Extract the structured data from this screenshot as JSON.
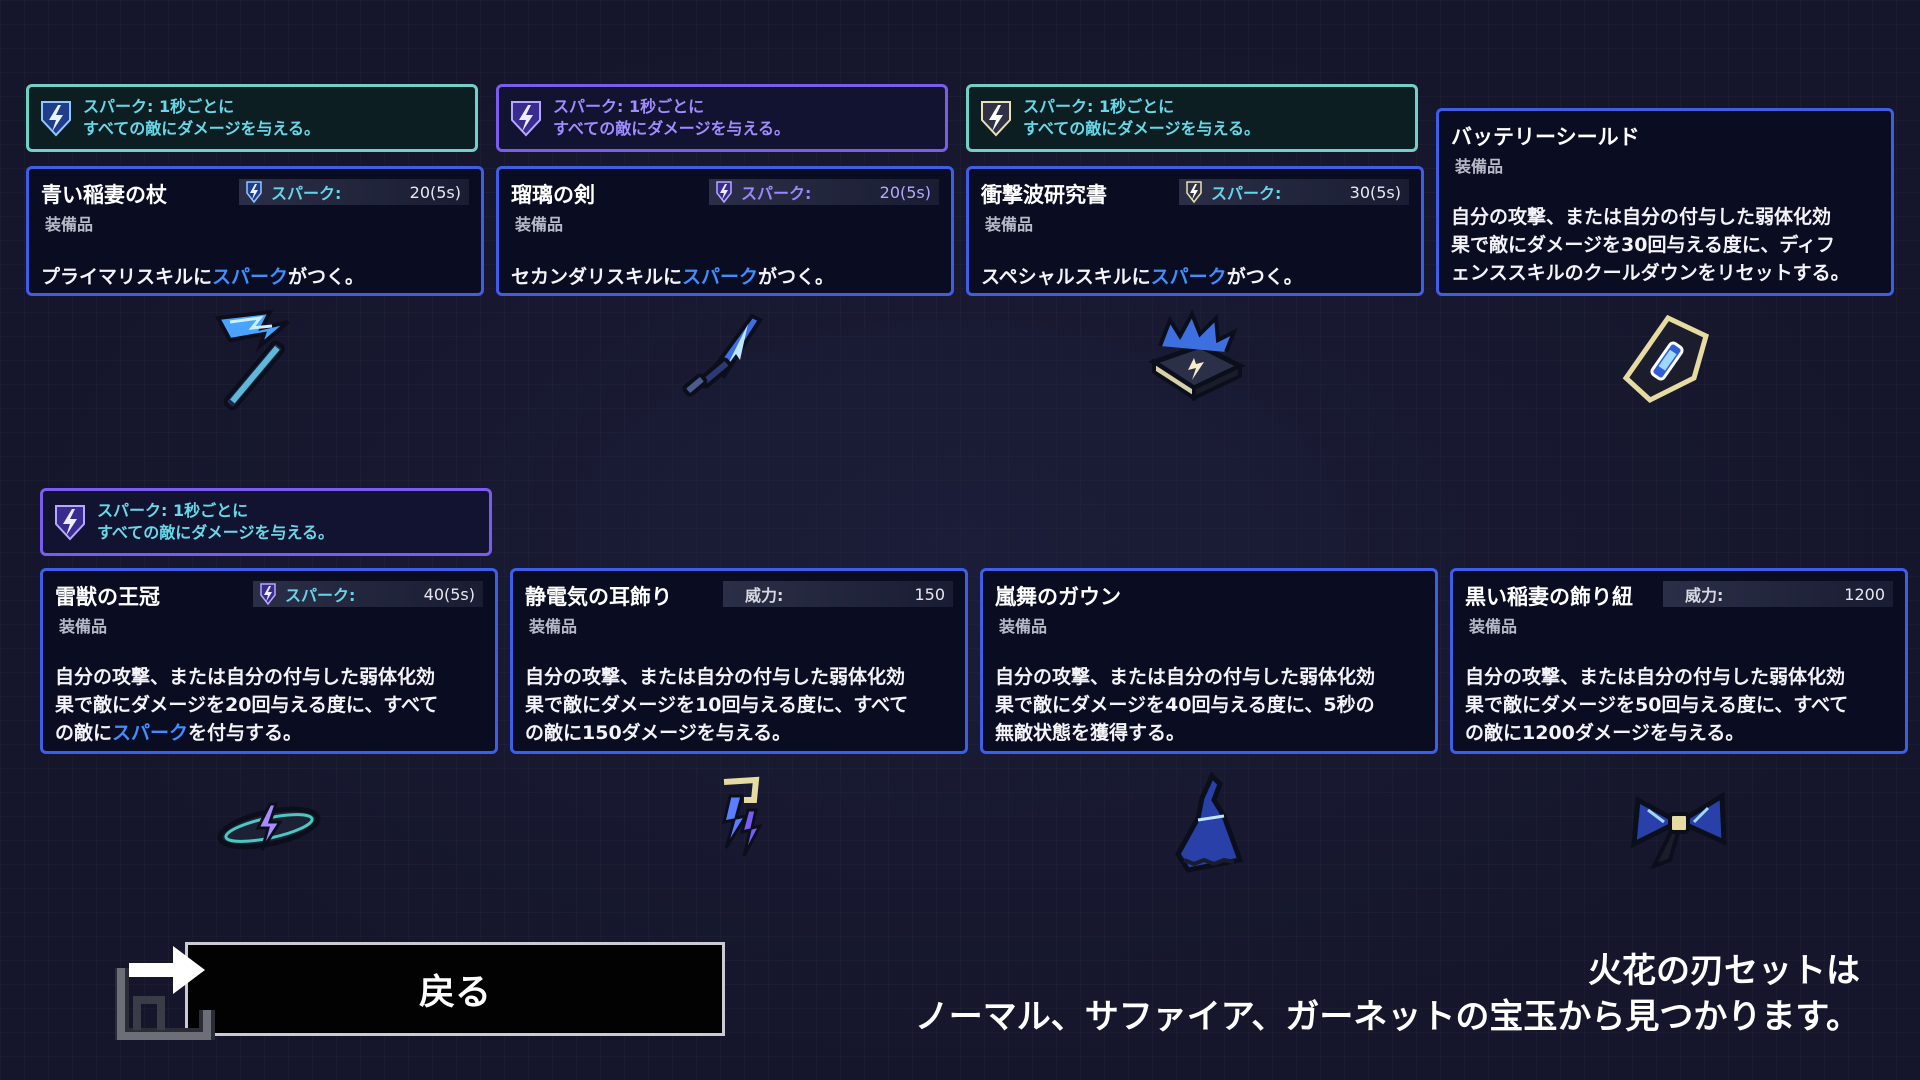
{
  "spark_tooltip": {
    "line1": "スパーク: 1秒ごとに",
    "line2": "すべての敵にダメージを与える。"
  },
  "equipment_type": "装備品",
  "top_row": [
    {
      "name": "青い稲妻の杖",
      "stat_label": "スパーク:",
      "stat_value": "20(5s)",
      "desc_pre": "プライマリスキルに",
      "desc_keyword": "スパーク",
      "desc_post": "がつく。"
    },
    {
      "name": "瑠璃の剣",
      "stat_label": "スパーク:",
      "stat_value": "20(5s)",
      "desc_pre": "セカンダリスキルに",
      "desc_keyword": "スパーク",
      "desc_post": "がつく。"
    },
    {
      "name": "衝撃波研究書",
      "stat_label": "スパーク:",
      "stat_value": "30(5s)",
      "desc_pre": "スペシャルスキルに",
      "desc_keyword": "スパーク",
      "desc_post": "がつく。"
    },
    {
      "name": "バッテリーシールド",
      "desc_line1": "自分の攻撃、または自分の付与した弱体化効",
      "desc_line2": "果で敵にダメージを30回与える度に、ディフ",
      "desc_line3": "ェンススキルのクールダウンをリセットする。"
    }
  ],
  "bottom_row": [
    {
      "name": "雷獣の王冠",
      "stat_label": "スパーク:",
      "stat_value": "40(5s)",
      "desc_line1": "自分の攻撃、または自分の付与した弱体化効",
      "desc_line2": "果で敵にダメージを20回与える度に、すべて",
      "desc_line3_pre": "の敵に",
      "desc_keyword": "スパーク",
      "desc_line3_post": "を付与する。"
    },
    {
      "name": "静電気の耳飾り",
      "stat_label": "威力:",
      "stat_value": "150",
      "desc_line1": "自分の攻撃、または自分の付与した弱体化効",
      "desc_line2": "果で敵にダメージを10回与える度に、すべて",
      "desc_line3": "の敵に150ダメージを与える。"
    },
    {
      "name": "嵐舞のガウン",
      "desc_line1": "自分の攻撃、または自分の付与した弱体化効",
      "desc_line2": "果で敵にダメージを40回与える度に、5秒の",
      "desc_line3": "無敵状態を獲得する。"
    },
    {
      "name": "黒い稲妻の飾り紐",
      "stat_label": "威力:",
      "stat_value": "1200",
      "desc_line1": "自分の攻撃、または自分の付与した弱体化効",
      "desc_line2": "果で敵にダメージを50回与える度に、すべて",
      "desc_line3": "の敵に1200ダメージを与える。"
    }
  ],
  "back_button": {
    "label": "戻る"
  },
  "footer": {
    "line1": "火花の刃セットは",
    "line2": "ノーマル、サファイア、ガーネットの宝玉から見つかります。"
  },
  "colors": {
    "card_border": "#3e5ee8",
    "tip_border_teal": "#6fd2c6",
    "tip_border_violet": "#7a5df0",
    "spark_keyword": "#3f8dff"
  }
}
